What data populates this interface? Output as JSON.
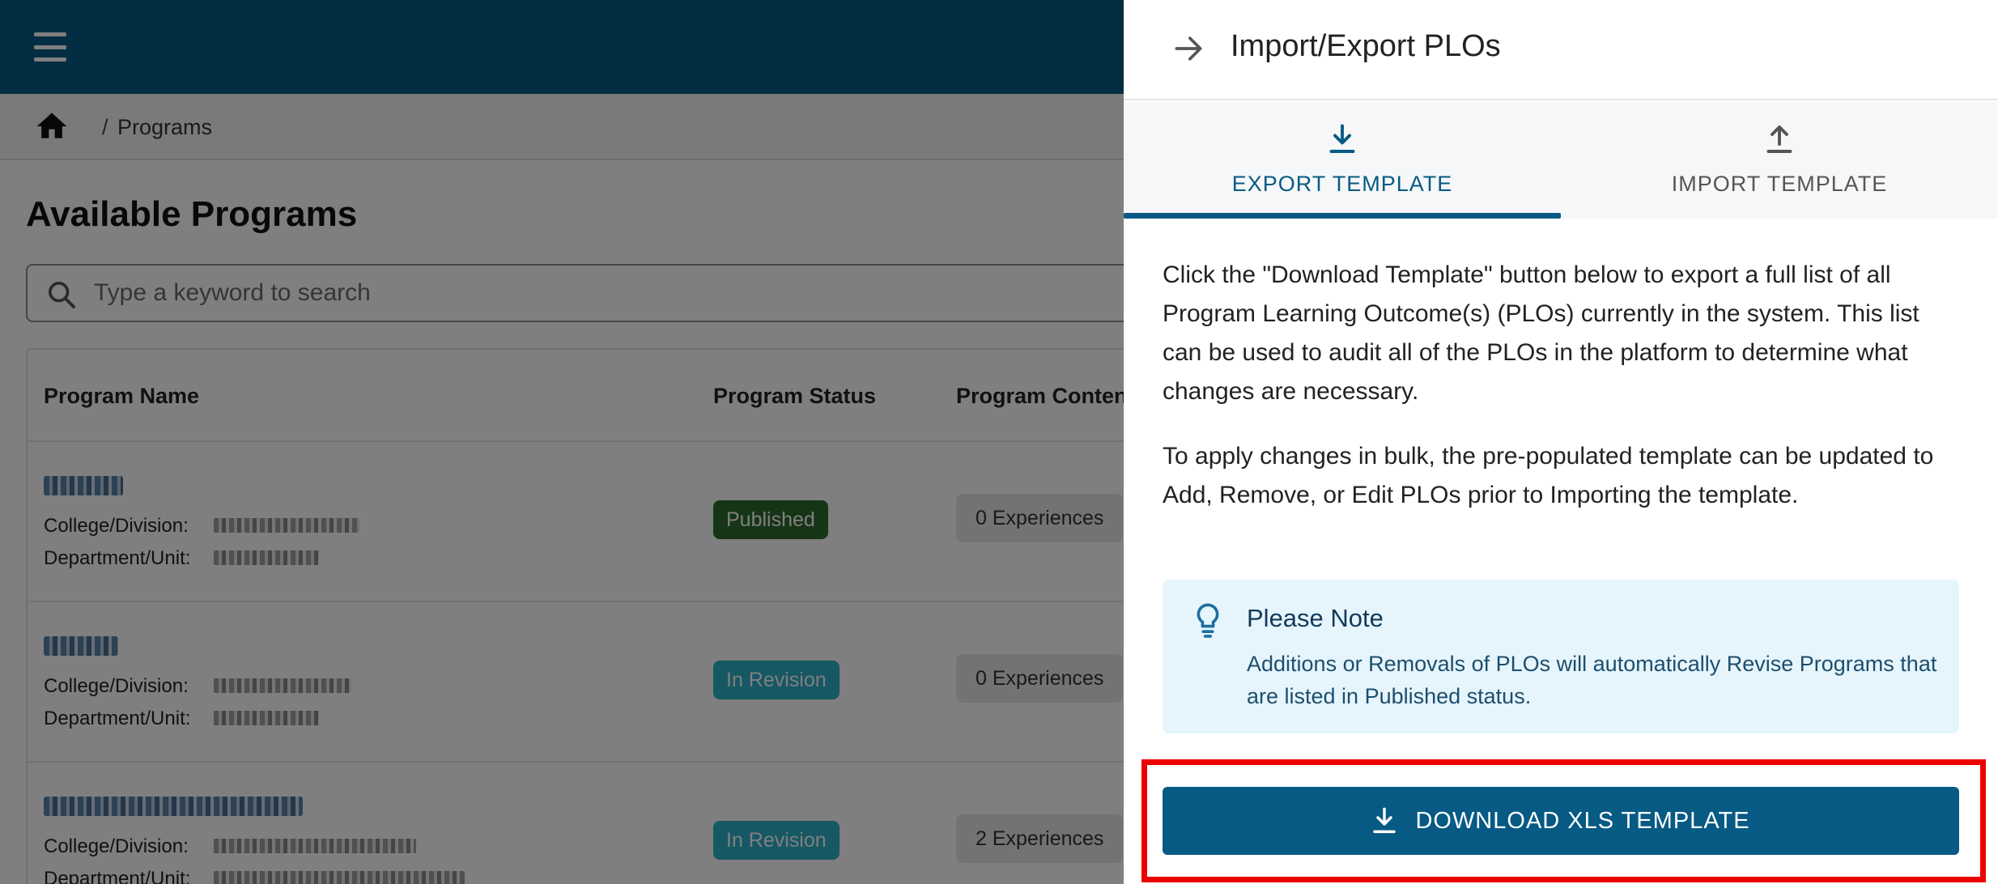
{
  "breadcrumb": {
    "separator": "/",
    "current": "Programs"
  },
  "page": {
    "title": "Available Programs"
  },
  "search": {
    "placeholder": "Type a keyword to search"
  },
  "table": {
    "headers": {
      "name": "Program Name",
      "status": "Program Status",
      "content": "Program Conten"
    },
    "rows": [
      {
        "college_label": "College/Division:",
        "department_label": "Department/Unit:",
        "status": "Published",
        "experiences": "0 Experiences"
      },
      {
        "college_label": "College/Division:",
        "department_label": "Department/Unit:",
        "status": "In Revision",
        "experiences": "0 Experiences"
      },
      {
        "college_label": "College/Division:",
        "department_label": "Department/Unit:",
        "status": "In Revision",
        "experiences": "2 Experiences"
      }
    ]
  },
  "drawer": {
    "title": "Import/Export PLOs",
    "tabs": [
      {
        "label": "EXPORT TEMPLATE",
        "icon": "download-icon",
        "active": true
      },
      {
        "label": "IMPORT TEMPLATE",
        "icon": "upload-icon",
        "active": false
      }
    ],
    "paragraph_1": "Click the \"Download Template\" button below to export a full list of all Program Learning Outcome(s) (PLOs) currently in the system. This list can be used to audit all of the PLOs in the platform to determine what changes are necessary.",
    "paragraph_2": "To apply changes in bulk, the pre-populated template can be updated to Add, Remove, or Edit PLOs prior to Importing the template.",
    "note": {
      "title": "Please Note",
      "body": "Additions or Removals of PLOs will automatically Revise Programs that are listed in Published status."
    },
    "download_button": "DOWNLOAD XLS TEMPLATE"
  },
  "colors": {
    "brand": "#075a84",
    "published": "#2d6a2d",
    "in_revision": "#2cb0c9",
    "highlight": "#ec0000",
    "note_bg": "#e6f5fb"
  }
}
